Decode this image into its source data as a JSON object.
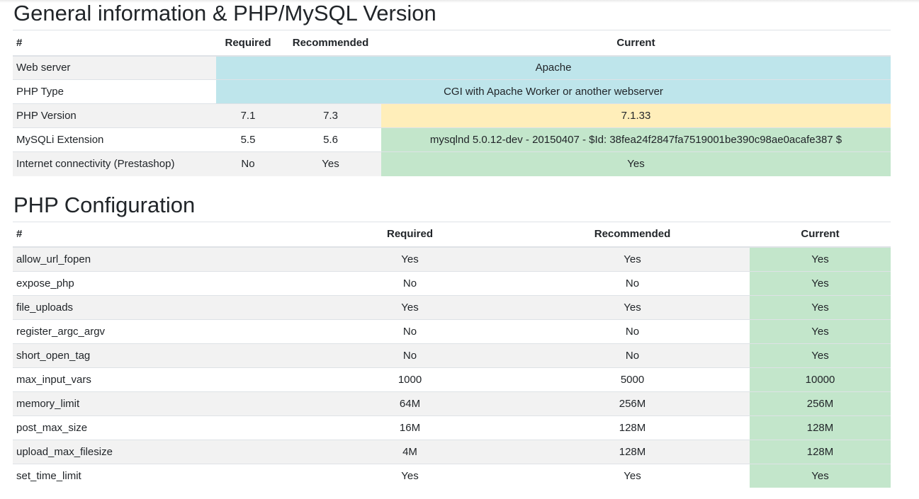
{
  "section1": {
    "title": "General information & PHP/MySQL Version",
    "headers": {
      "hash": "#",
      "required": "Required",
      "recommended": "Recommended",
      "current": "Current"
    },
    "rows": {
      "web_server": {
        "name": "Web server",
        "current": "Apache"
      },
      "php_type": {
        "name": "PHP Type",
        "current": "CGI with Apache Worker or another webserver"
      },
      "php_version": {
        "name": "PHP Version",
        "required": "7.1",
        "recommended": "7.3",
        "current": "7.1.33"
      },
      "mysqli": {
        "name": "MySQLi Extension",
        "required": "5.5",
        "recommended": "5.6",
        "current": "mysqlnd 5.0.12-dev - 20150407 - $Id: 38fea24f2847fa7519001be390c98ae0acafe387 $"
      },
      "internet": {
        "name": "Internet connectivity (Prestashop)",
        "required": "No",
        "recommended": "Yes",
        "current": "Yes"
      }
    }
  },
  "section2": {
    "title": "PHP Configuration",
    "headers": {
      "hash": "#",
      "required": "Required",
      "recommended": "Recommended",
      "current": "Current"
    },
    "rows": [
      {
        "name": "allow_url_fopen",
        "required": "Yes",
        "recommended": "Yes",
        "current": "Yes"
      },
      {
        "name": "expose_php",
        "required": "No",
        "recommended": "No",
        "current": "Yes"
      },
      {
        "name": "file_uploads",
        "required": "Yes",
        "recommended": "Yes",
        "current": "Yes"
      },
      {
        "name": "register_argc_argv",
        "required": "No",
        "recommended": "No",
        "current": "Yes"
      },
      {
        "name": "short_open_tag",
        "required": "No",
        "recommended": "No",
        "current": "Yes"
      },
      {
        "name": "max_input_vars",
        "required": "1000",
        "recommended": "5000",
        "current": "10000"
      },
      {
        "name": "memory_limit",
        "required": "64M",
        "recommended": "256M",
        "current": "256M"
      },
      {
        "name": "post_max_size",
        "required": "16M",
        "recommended": "128M",
        "current": "128M"
      },
      {
        "name": "upload_max_filesize",
        "required": "4M",
        "recommended": "128M",
        "current": "128M"
      },
      {
        "name": "set_time_limit",
        "required": "Yes",
        "recommended": "Yes",
        "current": "Yes"
      }
    ]
  }
}
